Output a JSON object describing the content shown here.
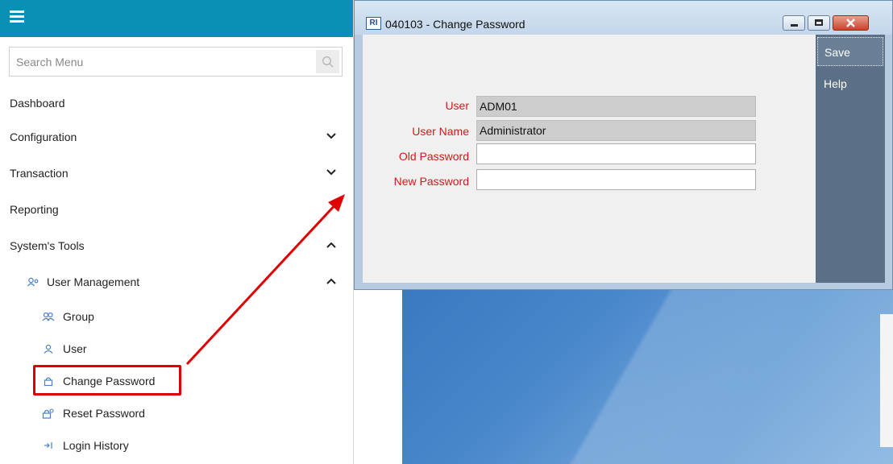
{
  "sidebar": {
    "search_placeholder": "Search Menu",
    "items": [
      {
        "label": "Dashboard"
      },
      {
        "label": "Configuration"
      },
      {
        "label": "Transaction"
      },
      {
        "label": "Reporting"
      },
      {
        "label": "System's Tools"
      }
    ],
    "user_management": {
      "label": "User Management",
      "children": [
        {
          "label": "Group"
        },
        {
          "label": "User"
        },
        {
          "label": "Change Password"
        },
        {
          "label": "Reset Password"
        },
        {
          "label": "Login History"
        }
      ]
    },
    "accent_color": "#0a8fb5",
    "highlight_color": "#e10000"
  },
  "window": {
    "app_icon_text": "RI",
    "title": "040103 - Change Password",
    "buttons": {
      "save": "Save",
      "help": "Help"
    },
    "fields": [
      {
        "label": "User",
        "value": "ADM01"
      },
      {
        "label": "User Name",
        "value": "Administrator"
      },
      {
        "label": "Old Password",
        "value": ""
      },
      {
        "label": "New Password",
        "value": ""
      }
    ],
    "label_color": "#d11a1a",
    "side_panel_color": "#5b6f87"
  }
}
